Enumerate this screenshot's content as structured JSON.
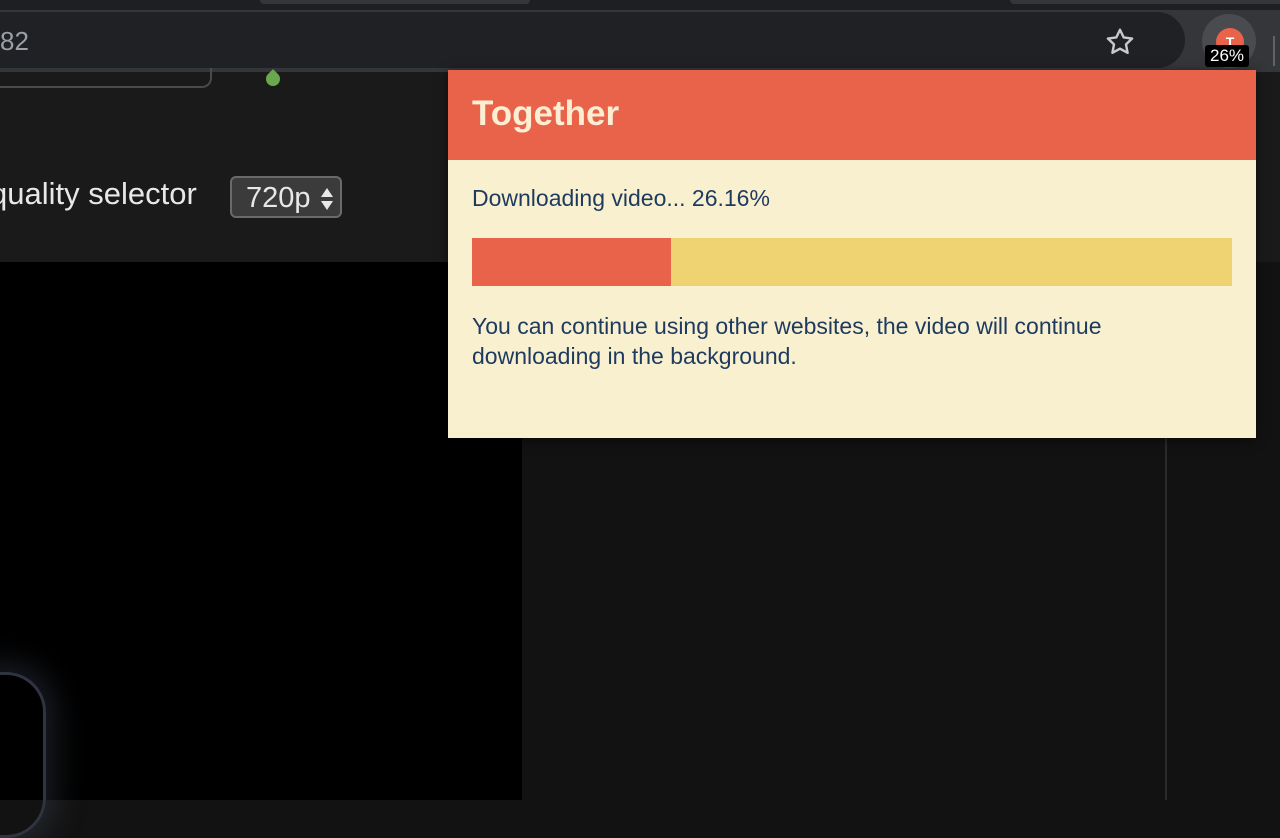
{
  "browser": {
    "address_text": "82",
    "extension_badge": "26%",
    "extension_initial": "T"
  },
  "page": {
    "quality_label": "quality selector",
    "quality_value": "720p"
  },
  "popup": {
    "title": "Together",
    "status": "Downloading video... 26.16%",
    "progress_percent": 26.16,
    "info": "You can continue using other websites, the video will continue downloading in the background."
  },
  "colors": {
    "accent": "#e8634a",
    "progress_track": "#efd372",
    "popup_bg": "#f8f0cf",
    "text": "#1e3a5f"
  }
}
